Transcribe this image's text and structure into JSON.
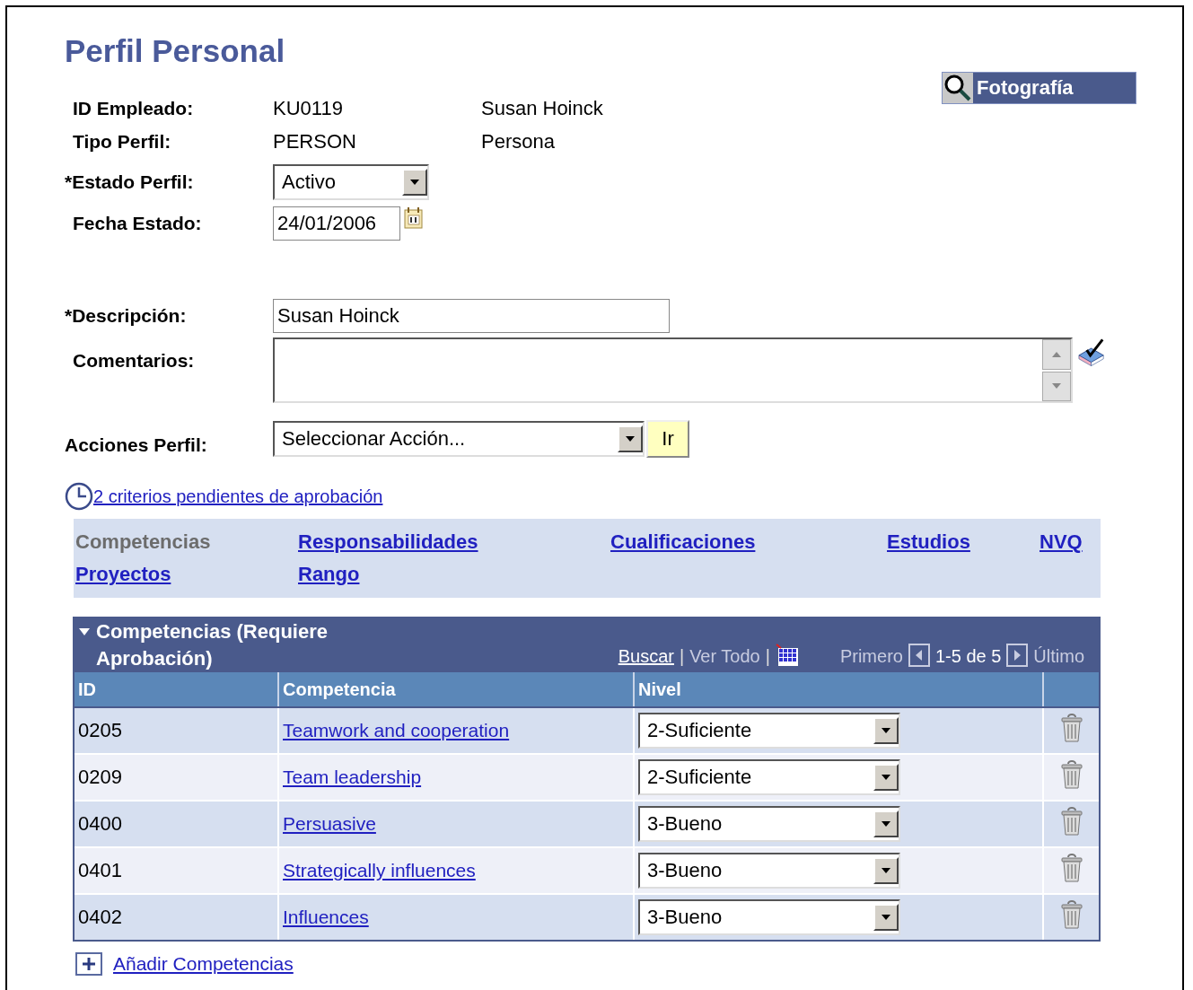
{
  "page_title": "Perfil Personal",
  "photo_button": "Fotografía",
  "info_rows": [
    {
      "label": "ID Empleado:",
      "value": "KU0119",
      "description": "Susan Hoinck"
    },
    {
      "label": "Tipo Perfil:",
      "value": "PERSON",
      "description": "Persona"
    }
  ],
  "status_field": {
    "label": "*Estado Perfil:",
    "value": "Activo"
  },
  "date_field": {
    "label": "Fecha Estado:",
    "value": "24/01/2006"
  },
  "description_field": {
    "label": "*Descripción:",
    "value": "Susan Hoinck"
  },
  "comments_field": {
    "label": "Comentarios:"
  },
  "actions_field": {
    "label": "Acciones Perfil:",
    "value": "Seleccionar Acción...",
    "button": "Ir"
  },
  "pending_link": "2 criterios pendientes de aprobación",
  "tabs": [
    {
      "label": "Competencias",
      "selected": true
    },
    {
      "label": "Responsabilidades",
      "selected": false
    },
    {
      "label": "Cualificaciones",
      "selected": false
    },
    {
      "label": "Estudios",
      "selected": false
    },
    {
      "label": "NVQ",
      "selected": false
    },
    {
      "label": "Proyectos",
      "selected": false
    },
    {
      "label": "Rango",
      "selected": false
    }
  ],
  "grid": {
    "title": "Competencias (Requiere Aprobación)",
    "search": "Buscar",
    "separator_1": "|",
    "view_all": "Ver Todo",
    "separator_2": "|",
    "first": "Primero",
    "range": "1-5 de 5",
    "last": "Último",
    "columns": [
      "ID",
      "Competencia",
      "Nivel"
    ],
    "rows": [
      {
        "id": "0205",
        "competency": "Teamwork and cooperation",
        "level": "2-Suficiente"
      },
      {
        "id": "0209",
        "competency": "Team leadership",
        "level": "2-Suficiente"
      },
      {
        "id": "0400",
        "competency": "Persuasive",
        "level": "3-Bueno"
      },
      {
        "id": "0401",
        "competency": "Strategically influences",
        "level": "3-Bueno"
      },
      {
        "id": "0402",
        "competency": "Influences",
        "level": "3-Bueno"
      }
    ]
  },
  "add_link": "Añadir Competencias"
}
